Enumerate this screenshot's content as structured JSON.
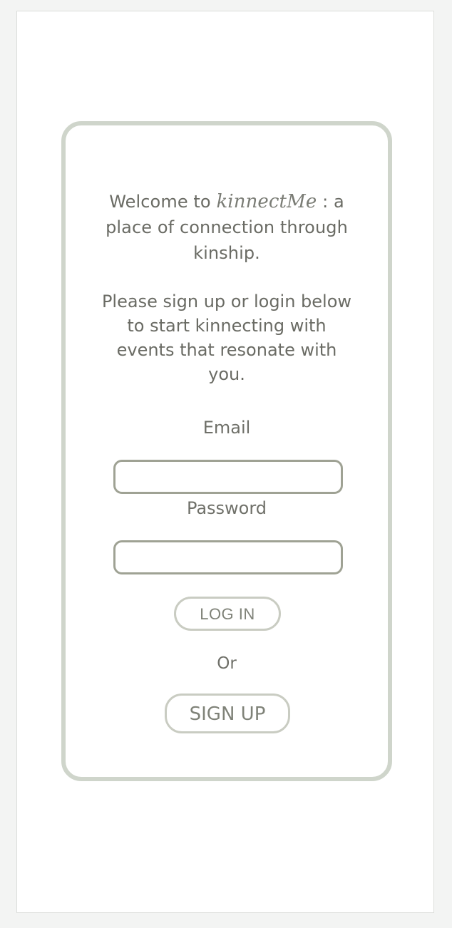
{
  "welcome": {
    "prefix": "Welcome to",
    "brand": "kinnectMe",
    "suffix": ": a",
    "line2": "place of connection through",
    "line3": "kinship."
  },
  "instructions": {
    "line1": "Please sign up or login below",
    "line2": "to start kinnecting with",
    "line3": "events that resonate with",
    "line4": "you."
  },
  "form": {
    "email_label": "Email",
    "email_value": "",
    "password_label": "Password",
    "password_value": "",
    "login_label": "LOG IN",
    "or_text": "Or",
    "signup_label": "SIGN UP"
  },
  "colors": {
    "card_border": "#cfd5cb",
    "text": "#6a6b64",
    "field_border": "#9fa294",
    "button_border": "#c9ccc2"
  }
}
